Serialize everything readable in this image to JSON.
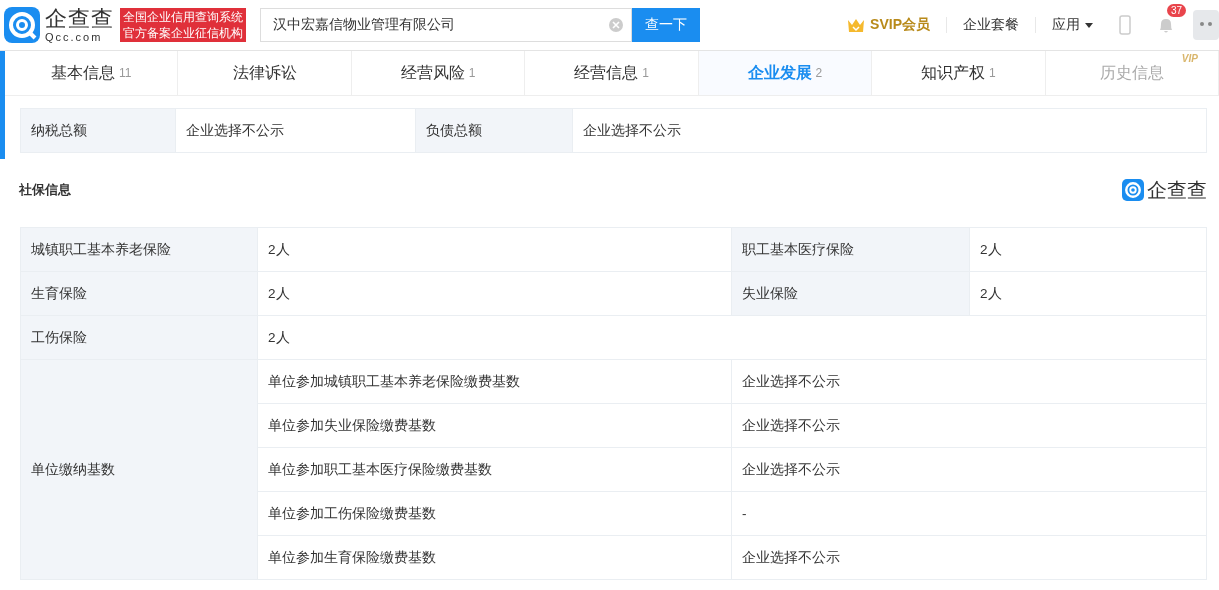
{
  "header": {
    "logo": {
      "name": "企查查",
      "domain": "Qcc.com"
    },
    "slogan": [
      "全国企业信用查询系统",
      "官方备案企业征信机构"
    ],
    "search": {
      "value": "汉中宏嘉信物业管理有限公司",
      "button": "查一下"
    },
    "nav": [
      {
        "kind": "vip",
        "label": "SVIP会员"
      },
      {
        "kind": "link",
        "label": "企业套餐"
      },
      {
        "kind": "menu",
        "label": "应用"
      }
    ],
    "notifications": "37"
  },
  "tabs": [
    {
      "label": "基本信息",
      "count": "11",
      "selected": false
    },
    {
      "label": "法律诉讼",
      "selected": false
    },
    {
      "label": "经营风险",
      "count": "1",
      "selected": false
    },
    {
      "label": "经营信息",
      "count": "1",
      "selected": false
    },
    {
      "label": "企业发展",
      "count": "2",
      "selected": true
    },
    {
      "label": "知识产权",
      "count": "1",
      "selected": false
    },
    {
      "label": "历史信息",
      "badge": "VIP",
      "selected": false
    }
  ],
  "finance": [
    {
      "label": "纳税总额",
      "value": "企业选择不公示",
      "label2": "负债总额",
      "value2": "企业选择不公示"
    }
  ],
  "social_insurance": {
    "title": "社保信息",
    "brand": "企查查",
    "counts": [
      {
        "label": "城镇职工基本养老保险",
        "value": "2人",
        "label2": "职工基本医疗保险",
        "value2": "2人"
      },
      {
        "label": "生育保险",
        "value": "2人",
        "label2": "失业保险",
        "value2": "2人"
      },
      {
        "label": "工伤保险",
        "value": "2人"
      }
    ],
    "base": {
      "label": "单位缴纳基数",
      "items": [
        {
          "name": "单位参加城镇职工基本养老保险缴费基数",
          "value": "企业选择不公示"
        },
        {
          "name": "单位参加失业保险缴费基数",
          "value": "企业选择不公示"
        },
        {
          "name": "单位参加职工基本医疗保险缴费基数",
          "value": "企业选择不公示"
        },
        {
          "name": "单位参加工伤保险缴费基数",
          "value": "-"
        },
        {
          "name": "单位参加生育保险缴费基数",
          "value": "企业选择不公示"
        }
      ]
    }
  }
}
